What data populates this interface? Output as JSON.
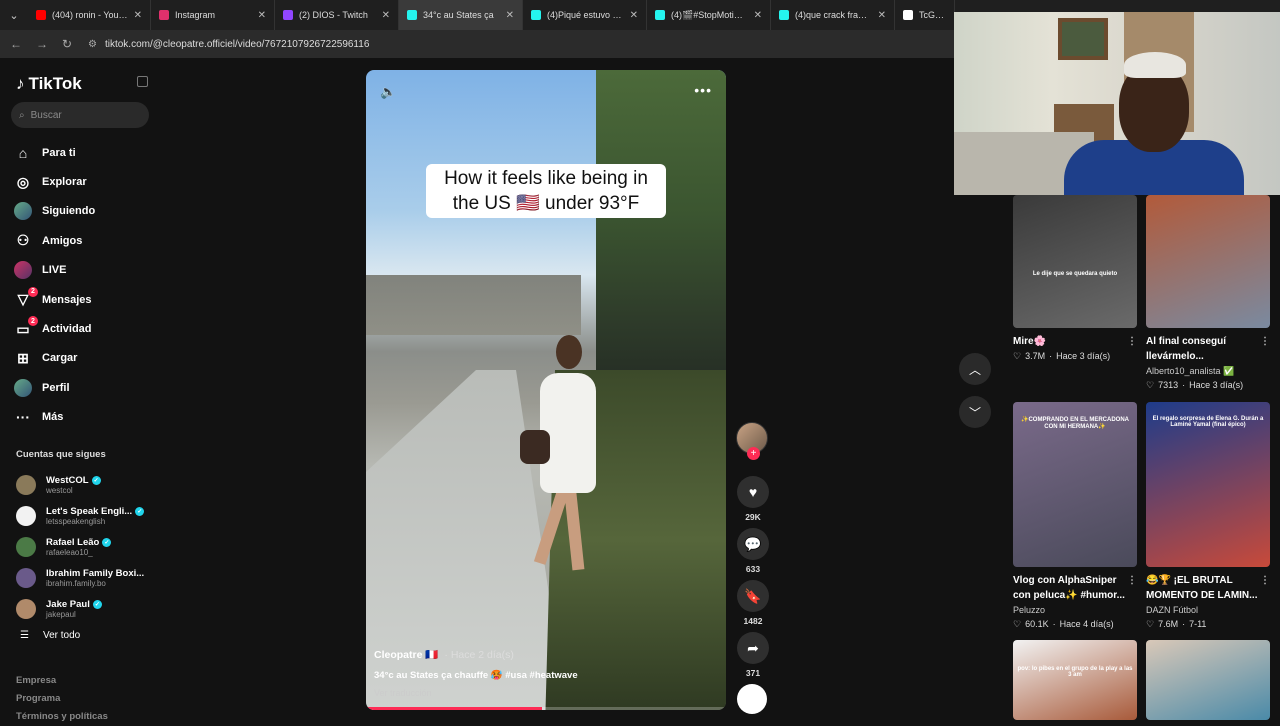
{
  "browser": {
    "tabs": [
      {
        "title": "(404) ronin - YouTube",
        "color": "#ff0000",
        "active": false
      },
      {
        "title": "Instagram",
        "color": "#e1306c",
        "active": false
      },
      {
        "title": "(2) DIOS - Twitch",
        "color": "#9146ff",
        "active": false
      },
      {
        "title": "34°c au States ça",
        "color": "#25f4ee",
        "active": true
      },
      {
        "title": "(4)Piqué estuvo en el",
        "color": "#25f4ee",
        "active": false
      },
      {
        "title": "(4)🎬#StopMotion |",
        "color": "#25f4ee",
        "active": false
      },
      {
        "title": "(4)que crack franitoo",
        "color": "#25f4ee",
        "active": false
      },
      {
        "title": "TcGE25Jos",
        "color": "#ffffff",
        "active": false
      }
    ],
    "url": "tiktok.com/@cleopatre.officiel/video/7672107926722596116"
  },
  "sidebar": {
    "logo": "TikTok",
    "search_placeholder": "Buscar",
    "nav": [
      {
        "label": "Para ti",
        "icon": "home-icon"
      },
      {
        "label": "Explorar",
        "icon": "compass-icon"
      },
      {
        "label": "Siguiendo",
        "icon": "avatar-icon"
      },
      {
        "label": "Amigos",
        "icon": "friends-icon"
      },
      {
        "label": "LIVE",
        "icon": "live-icon"
      },
      {
        "label": "Mensajes",
        "icon": "messages-icon",
        "badge": "2"
      },
      {
        "label": "Actividad",
        "icon": "activity-icon",
        "badge": "2"
      },
      {
        "label": "Cargar",
        "icon": "upload-icon"
      },
      {
        "label": "Perfil",
        "icon": "profile-icon"
      },
      {
        "label": "Más",
        "icon": "more-icon"
      }
    ],
    "following_title": "Cuentas que sigues",
    "accounts": [
      {
        "name": "WestCOL",
        "handle": "westcol",
        "verified": true,
        "color": "#8a7a5a"
      },
      {
        "name": "Let's Speak Engli...",
        "handle": "letsspeakenglish",
        "verified": true,
        "color": "#f2f2f2"
      },
      {
        "name": "Rafael Leão",
        "handle": "rafaeleao10_",
        "verified": true,
        "color": "#4b7a46"
      },
      {
        "name": "Ibrahim Family Boxi...",
        "handle": "ibrahim.family.bo",
        "verified": false,
        "color": "#6a5a8a"
      },
      {
        "name": "Jake Paul",
        "handle": "jakepaul",
        "verified": true,
        "color": "#b08a6a"
      }
    ],
    "see_all": "Ver todo",
    "footer": [
      "Empresa",
      "Programa",
      "Términos y políticas"
    ]
  },
  "video": {
    "caption": "How it feels like being in the US 🇺🇸 under 93°F",
    "author": "Cleopatre 🇫🇷",
    "time": "· Hace 2 día(s)",
    "description": "34°c au States ça chauffe 🥵 #usa #heatwave",
    "translate": "Ver traducción",
    "progress": 0.49
  },
  "actions": {
    "likes": "29K",
    "comments": "633",
    "saves": "1482",
    "shares": "371"
  },
  "rail": [
    {
      "title": "Mire🌸",
      "author": "",
      "views": "3.7M",
      "time": "Hace 3 día(s)",
      "caption": "Le dije que se quedara quieto",
      "c1": "#3a3a3a",
      "c2": "#6a6a6a"
    },
    {
      "title": "Al final conseguí llevármelo...",
      "author": "Alberto10_analista ✅",
      "views": "7313",
      "time": "Hace 3 día(s)",
      "caption": "",
      "c1": "#b25a3a",
      "c2": "#7a8aa0"
    },
    {
      "title": "Vlog con AlphaSniper con peluca✨ #humor...",
      "author": "Peluzzo",
      "views": "60.1K",
      "time": "Hace 4 día(s)",
      "caption": "✨COMPRANDO EN EL MERCADONA CON MI HERMANA✨",
      "c1": "#7a6a8a",
      "c2": "#4a4a5a"
    },
    {
      "title": "😂🏆 ¡EL BRUTAL MOMENTO DE LAMIN...",
      "author": "DAZN Fútbol",
      "views": "7.6M",
      "time": "7-11",
      "caption": "El regalo sorpresa de Elena G. Durán a Lamine Yamal (final épico)",
      "c1": "#1e3c8a",
      "c2": "#c84a3a"
    },
    {
      "title": "",
      "author": "",
      "views": "",
      "time": "",
      "caption": "pov: lo pibes en el grupo de la play a las 3 am",
      "c1": "#f2f2f2",
      "c2": "#a85a3a"
    },
    {
      "title": "",
      "author": "",
      "views": "",
      "time": "",
      "caption": "",
      "c1": "#d9c8b8",
      "c2": "#4a8aa8"
    }
  ]
}
